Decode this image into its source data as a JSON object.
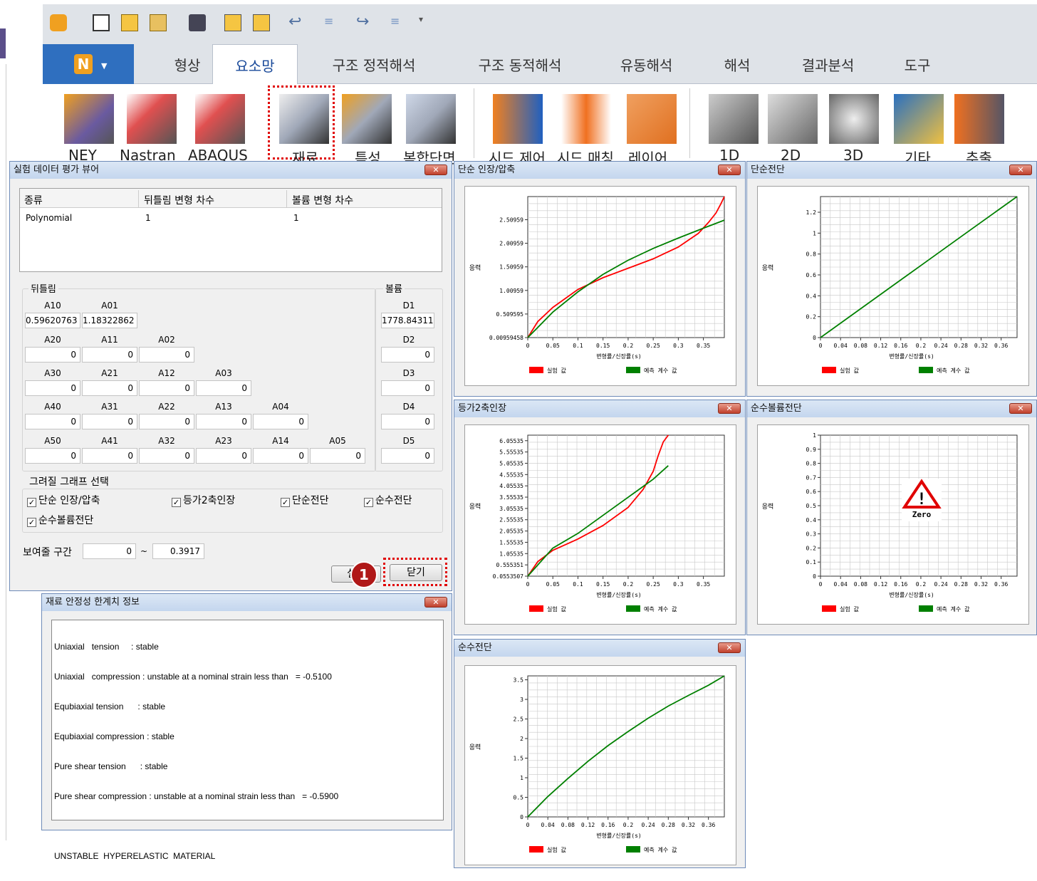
{
  "ribbon": {
    "tabs": [
      "형상",
      "요소망",
      "구조 정적해석",
      "구조 동적해석",
      "유동해석",
      "해석",
      "결과분석",
      "도구"
    ],
    "active_tab": "요소망",
    "tools": [
      "NEY",
      "Nastran",
      "ABAQUS",
      "재료",
      "특성",
      "복합단면",
      "시드 제어",
      "시드 매칭",
      "레이어",
      "1D",
      "2D",
      "3D",
      "기타",
      "추출"
    ]
  },
  "viewer": {
    "title": "실험 데이터 평가 뷰어",
    "table": {
      "headers": [
        "종류",
        "뒤틀림 변형 차수",
        "볼륨 변형 차수"
      ],
      "row": [
        "Polynomial",
        "1",
        "1"
      ]
    },
    "distortion": {
      "title": "뒤틀림",
      "r1_labels": [
        "A10",
        "A01"
      ],
      "r1_values": [
        "0.59620763",
        "1.18322862"
      ],
      "r2_labels": [
        "A20",
        "A11",
        "A02"
      ],
      "r2_values": [
        "0",
        "0",
        "0"
      ],
      "r3_labels": [
        "A30",
        "A21",
        "A12",
        "A03"
      ],
      "r3_values": [
        "0",
        "0",
        "0",
        "0"
      ],
      "r4_labels": [
        "A40",
        "A31",
        "A22",
        "A13",
        "A04"
      ],
      "r4_values": [
        "0",
        "0",
        "0",
        "0",
        "0"
      ],
      "r5_labels": [
        "A50",
        "A41",
        "A32",
        "A23",
        "A14",
        "A05"
      ],
      "r5_values": [
        "0",
        "0",
        "0",
        "0",
        "0",
        "0"
      ]
    },
    "volume": {
      "title": "볼륨",
      "labels": [
        "D1",
        "D2",
        "D3",
        "D4",
        "D5"
      ],
      "values": [
        "1778.84311",
        "0",
        "0",
        "0",
        "0"
      ]
    },
    "graph_select": {
      "title": "그려질 그래프 선택",
      "options": [
        "단순 인장/압축",
        "등가2축인장",
        "단순전단",
        "순수전단",
        "순수볼륨전단"
      ]
    },
    "range": {
      "label": "보여줄 구간",
      "from": "0",
      "tilde": "~",
      "to": "0.3917"
    },
    "run_label": "실행",
    "close_label": "닫기",
    "badge": "1"
  },
  "stability": {
    "title": "재료 안정성 한계치 정보",
    "lines": [
      "Uniaxial   tension     : stable",
      "Uniaxial   compression : unstable at a nominal strain less than   = -0.5100",
      "Equbiaxial tension      : stable",
      "Equbiaxial compression : stable",
      "Pure shear tension      : stable",
      "Pure shear compression : unstable at a nominal strain less than   = -0.5900",
      "",
      "UNSTABLE  HYPERELASTIC  MATERIAL"
    ]
  },
  "close_x": "✕",
  "chart_data": [
    {
      "id": "uniaxial",
      "title": "단순 인장/압축",
      "type": "line",
      "xlabel": "변형률/신장률(s)",
      "ylabel": "응력",
      "x_ticks": [
        "0",
        "0.05",
        "0.1",
        "0.15",
        "0.2",
        "0.25",
        "0.3",
        "0.35"
      ],
      "y_ticks": [
        "0.00959458",
        "0.509595",
        "1.00959",
        "1.50959",
        "2.00959",
        "2.50959"
      ],
      "xlim": [
        0,
        0.3917
      ],
      "ylim": [
        0.0096,
        3.0
      ],
      "series": [
        {
          "name": "실험 값",
          "color": "#ff0000",
          "x": [
            0,
            0.02,
            0.05,
            0.1,
            0.15,
            0.2,
            0.25,
            0.3,
            0.34,
            0.36,
            0.375,
            0.385,
            0.3917
          ],
          "y": [
            0.0096,
            0.35,
            0.65,
            1.03,
            1.28,
            1.48,
            1.68,
            1.93,
            2.22,
            2.45,
            2.65,
            2.85,
            3.0
          ]
        },
        {
          "name": "예측 계수 값",
          "color": "#008000",
          "x": [
            0,
            0.05,
            0.1,
            0.15,
            0.2,
            0.25,
            0.3,
            0.35,
            0.3917
          ],
          "y": [
            0.0096,
            0.55,
            0.98,
            1.35,
            1.65,
            1.9,
            2.12,
            2.33,
            2.5
          ]
        }
      ]
    },
    {
      "id": "simple_shear",
      "title": "단순전단",
      "type": "line",
      "xlabel": "변형률/신장률(s)",
      "ylabel": "응력",
      "x_ticks": [
        "0",
        "0.04",
        "0.08",
        "0.12",
        "0.16",
        "0.2",
        "0.24",
        "0.28",
        "0.32",
        "0.36"
      ],
      "y_ticks": [
        "0",
        "0.2",
        "0.4",
        "0.6",
        "0.8",
        "1",
        "1.2"
      ],
      "xlim": [
        0,
        0.3917
      ],
      "ylim": [
        0,
        1.35
      ],
      "series": [
        {
          "name": "실험 값",
          "color": "#ff0000",
          "x": [],
          "y": []
        },
        {
          "name": "예측 계수 값",
          "color": "#008000",
          "x": [
            0,
            0.1,
            0.2,
            0.3,
            0.3917
          ],
          "y": [
            0,
            0.345,
            0.69,
            1.035,
            1.35
          ]
        }
      ]
    },
    {
      "id": "equibiaxial",
      "title": "등가2축인장",
      "type": "line",
      "xlabel": "변형률/신장률(s)",
      "ylabel": "응력",
      "x_ticks": [
        "0",
        "0.05",
        "0.1",
        "0.15",
        "0.2",
        "0.25",
        "0.3",
        "0.35"
      ],
      "y_ticks": [
        "0.0553507",
        "0.555351",
        "1.05535",
        "1.55535",
        "2.05535",
        "2.55535",
        "3.05535",
        "3.55535",
        "4.05535",
        "4.55535",
        "5.05535",
        "5.55535",
        "6.05535"
      ],
      "xlim": [
        0,
        0.3917
      ],
      "ylim": [
        0.0554,
        6.3
      ],
      "series": [
        {
          "name": "실험 값",
          "color": "#ff0000",
          "x": [
            0,
            0.02,
            0.05,
            0.1,
            0.15,
            0.2,
            0.23,
            0.25,
            0.26,
            0.27,
            0.28
          ],
          "y": [
            0.0554,
            0.7,
            1.2,
            1.7,
            2.3,
            3.1,
            3.9,
            4.7,
            5.4,
            6.0,
            6.3
          ]
        },
        {
          "name": "예측 계수 값",
          "color": "#008000",
          "x": [
            0,
            0.05,
            0.1,
            0.15,
            0.2,
            0.25,
            0.28
          ],
          "y": [
            0.0554,
            1.3,
            1.95,
            2.75,
            3.55,
            4.35,
            4.95
          ]
        }
      ]
    },
    {
      "id": "volumetric",
      "title": "순수볼륨전단",
      "type": "line",
      "xlabel": "변형률/신장률(s)",
      "ylabel": "응력",
      "x_ticks": [
        "0",
        "0.04",
        "0.08",
        "0.12",
        "0.16",
        "0.2",
        "0.24",
        "0.28",
        "0.32",
        "0.36"
      ],
      "y_ticks": [
        "0",
        "0.1",
        "0.2",
        "0.3",
        "0.4",
        "0.5",
        "0.6",
        "0.7",
        "0.8",
        "0.9",
        "1"
      ],
      "xlim": [
        0,
        0.3917
      ],
      "ylim": [
        0,
        1
      ],
      "zero_label": "Zero",
      "series": [
        {
          "name": "실험 값",
          "color": "#ff0000",
          "x": [],
          "y": []
        },
        {
          "name": "예측 계수 값",
          "color": "#008000",
          "x": [],
          "y": []
        }
      ]
    },
    {
      "id": "pure_shear",
      "title": "순수전단",
      "type": "line",
      "xlabel": "변형률/신장률(s)",
      "ylabel": "응력",
      "x_ticks": [
        "0",
        "0.04",
        "0.08",
        "0.12",
        "0.16",
        "0.2",
        "0.24",
        "0.28",
        "0.32",
        "0.36"
      ],
      "y_ticks": [
        "0",
        "0.5",
        "1",
        "1.5",
        "2",
        "2.5",
        "3",
        "3.5"
      ],
      "xlim": [
        0,
        0.3917
      ],
      "ylim": [
        0,
        3.6
      ],
      "series": [
        {
          "name": "실험 값",
          "color": "#ff0000",
          "x": [],
          "y": []
        },
        {
          "name": "예측 계수 값",
          "color": "#008000",
          "x": [
            0,
            0.04,
            0.08,
            0.12,
            0.16,
            0.2,
            0.24,
            0.28,
            0.32,
            0.36,
            0.3917
          ],
          "y": [
            0,
            0.52,
            0.98,
            1.42,
            1.82,
            2.18,
            2.52,
            2.83,
            3.1,
            3.36,
            3.6
          ]
        }
      ]
    }
  ]
}
